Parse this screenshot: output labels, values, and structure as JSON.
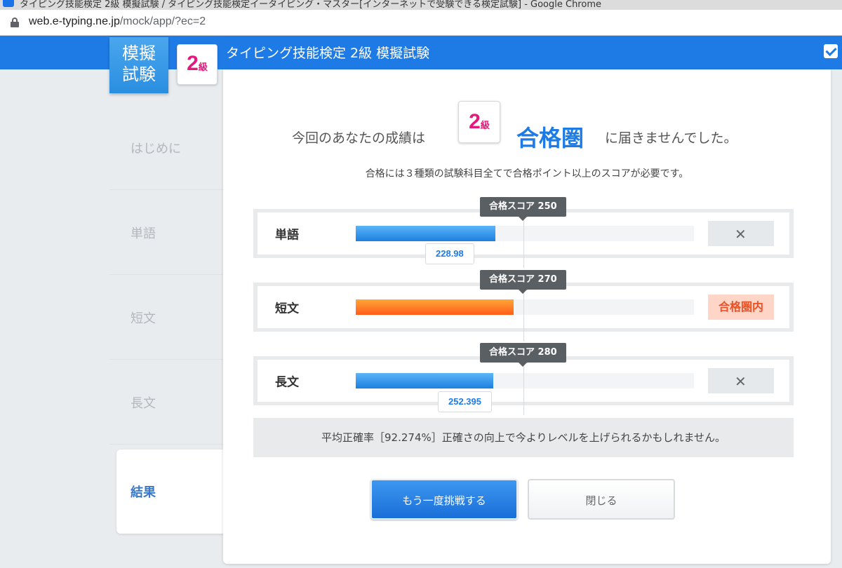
{
  "browser": {
    "window_title": "タイピング技能検定 2級 模擬試験 / タイピング技能検定イータイピング・マスター[インターネットで受験できる検定試験] - Google Chrome",
    "url_host": "web.e-typing.ne.jp",
    "url_path": "/mock/app/?ec=2"
  },
  "header": {
    "mock_line1": "模擬",
    "mock_line2": "試験",
    "grade_num": "2",
    "grade_unit": "級",
    "title": "タイピング技能検定 2級 模擬試験"
  },
  "sidebar": {
    "items": [
      {
        "label": "はじめに"
      },
      {
        "label": "単語"
      },
      {
        "label": "短文"
      },
      {
        "label": "長文"
      },
      {
        "label": "結果"
      }
    ],
    "active_index": 4
  },
  "result": {
    "prefix": "今回のあなたの成績は",
    "grade_num": "2",
    "grade_unit": "級",
    "highlight": "合格圏",
    "suffix": "に届きませんでした。",
    "note": "合格には３種類の試験科目全てで合格ポイント以上のスコアが必要です。"
  },
  "scores": [
    {
      "subject": "単語",
      "pass_label": "合格スコア 250",
      "value_label": "228.98",
      "value": 228.98,
      "pass_score": 250,
      "passed": false,
      "status_text": "✕",
      "bar_color": "blue"
    },
    {
      "subject": "短文",
      "pass_label": "合格スコア 270",
      "value_label": "",
      "value": 280,
      "pass_score": 270,
      "passed": true,
      "status_text": "合格圏内",
      "bar_color": "orange"
    },
    {
      "subject": "長文",
      "pass_label": "合格スコア 280",
      "value_label": "252.395",
      "value": 252.395,
      "pass_score": 280,
      "passed": false,
      "status_text": "✕",
      "bar_color": "blue"
    }
  ],
  "accuracy_message": "平均正確率［92.274%］正確さの向上で今よりレベルを上げられるかもしれません。",
  "buttons": {
    "retry": "もう一度挑戦する",
    "close": "閉じる"
  },
  "colors": {
    "header_blue": "#1e7be6",
    "grade_pink": "#e5197d",
    "pass_orange": "#f04f22"
  }
}
